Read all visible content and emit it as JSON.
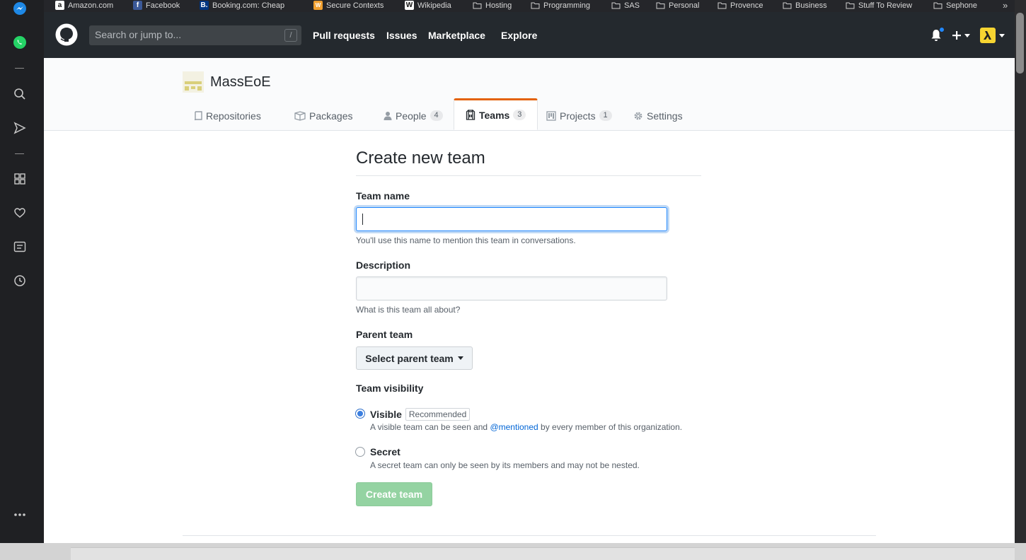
{
  "bookmarks": [
    {
      "label": "Amazon.com",
      "icon": "amazon-icon",
      "color": "#ffffff"
    },
    {
      "label": "Facebook",
      "icon": "facebook-icon",
      "color": "#3b5998"
    },
    {
      "label": "Booking.com: Cheap",
      "icon": "booking-icon",
      "color": "#003580"
    },
    {
      "label": "Secure Contexts",
      "icon": "w3c-icon",
      "color": "#f0a030"
    },
    {
      "label": "Wikipedia",
      "icon": "wikipedia-icon",
      "color": "#ffffff"
    },
    {
      "label": "Hosting",
      "icon": "folder-icon"
    },
    {
      "label": "Programming",
      "icon": "folder-icon"
    },
    {
      "label": "SAS",
      "icon": "folder-icon"
    },
    {
      "label": "Personal",
      "icon": "folder-icon"
    },
    {
      "label": "Provence",
      "icon": "folder-icon"
    },
    {
      "label": "Business",
      "icon": "folder-icon"
    },
    {
      "label": "Stuff To Review",
      "icon": "folder-icon"
    },
    {
      "label": "Sephone",
      "icon": "folder-icon"
    }
  ],
  "sidebar": {
    "icons": [
      "messenger-icon",
      "whatsapp-icon",
      "search-icon",
      "send-icon",
      "grid-icon",
      "heart-icon",
      "notes-icon",
      "clock-icon",
      "more-icon"
    ]
  },
  "header": {
    "search_placeholder": "Search or jump to...",
    "slash_key": "/",
    "nav": [
      "Pull requests",
      "Issues",
      "Marketplace",
      "Explore"
    ],
    "notification_dot_color": "#2188ff"
  },
  "org": {
    "name": "MassEoE",
    "tabs": [
      {
        "label": "Repositories",
        "icon": "repo-icon",
        "count": ""
      },
      {
        "label": "Packages",
        "icon": "package-icon",
        "count": ""
      },
      {
        "label": "People",
        "icon": "person-icon",
        "count": "4"
      },
      {
        "label": "Teams",
        "icon": "jersey-icon",
        "count": "3",
        "selected": true
      },
      {
        "label": "Projects",
        "icon": "project-icon",
        "count": "1"
      },
      {
        "label": "Settings",
        "icon": "gear-icon",
        "count": ""
      }
    ]
  },
  "form": {
    "title": "Create new team",
    "team_name": {
      "label": "Team name",
      "value": "",
      "note": "You'll use this name to mention this team in conversations."
    },
    "description": {
      "label": "Description",
      "value": "",
      "note": "What is this team all about?"
    },
    "parent_team": {
      "label": "Parent team",
      "button": "Select parent team"
    },
    "visibility": {
      "label": "Team visibility",
      "options": [
        {
          "title": "Visible",
          "badge": "Recommended",
          "desc_before": "A visible team can be seen and ",
          "desc_link": "@mentioned",
          "desc_after": " by every member of this organization.",
          "selected": true
        },
        {
          "title": "Secret",
          "badge": "",
          "desc_before": "A secret team can only be seen by its members and may not be nested.",
          "desc_link": "",
          "desc_after": "",
          "selected": false
        }
      ]
    },
    "submit": "Create team",
    "submit_color": "#94d3a2"
  }
}
